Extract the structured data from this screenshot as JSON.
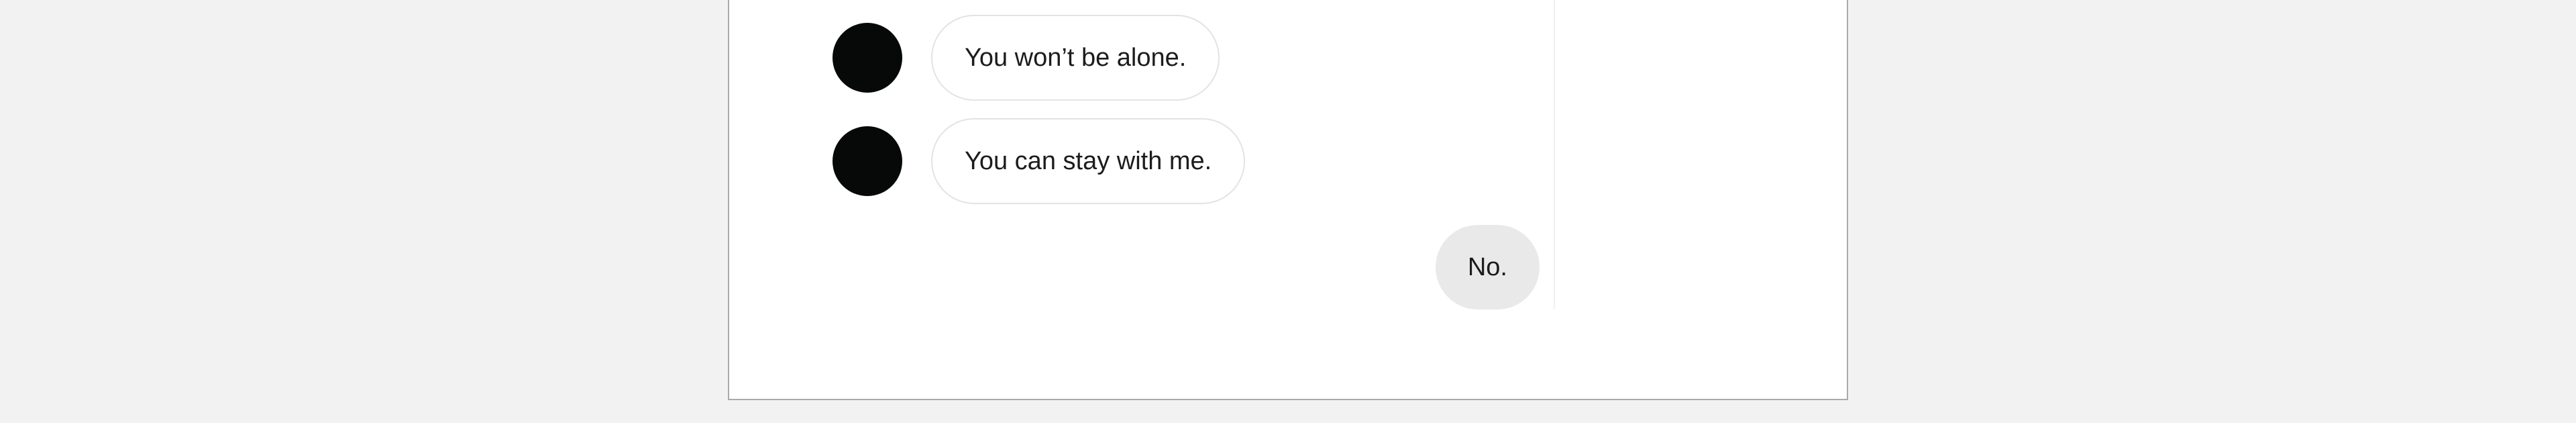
{
  "chat": {
    "messages": [
      {
        "sender": "other",
        "text": "You won’t be alone."
      },
      {
        "sender": "other",
        "text": "You can stay with me."
      },
      {
        "sender": "self",
        "text": "No."
      }
    ]
  },
  "colors": {
    "page_background": "#f2f2f2",
    "panel_background": "#ffffff",
    "avatar": "#060908",
    "incoming_bubble_border": "#e3e3e3",
    "outgoing_bubble": "#e9e9e9",
    "text": "#1c1c1c"
  }
}
